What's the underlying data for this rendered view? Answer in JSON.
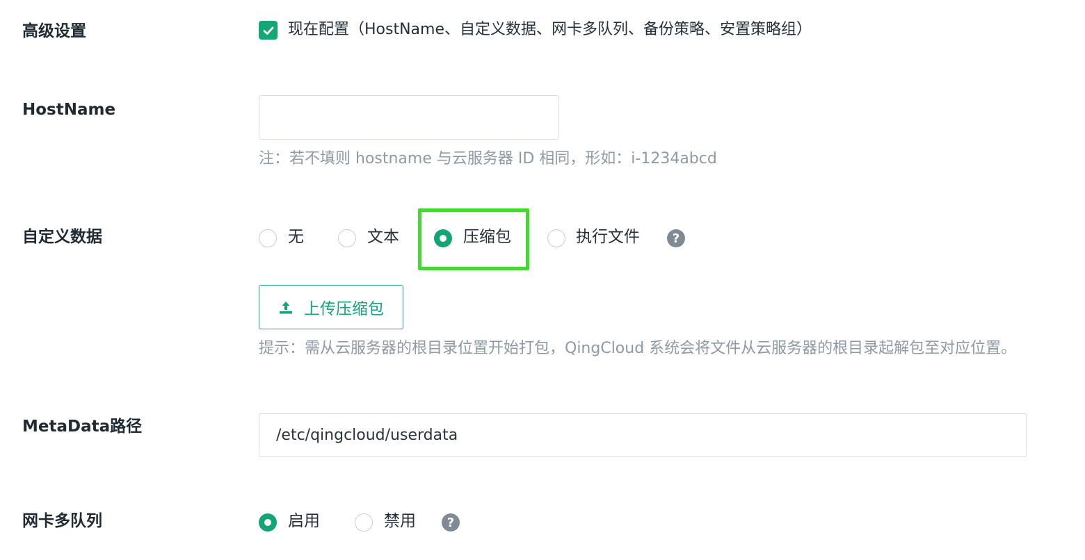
{
  "advanced": {
    "label": "高级设置",
    "checkbox_checked": true,
    "checkbox_text": "现在配置（HostName、自定义数据、网卡多队列、备份策略、安置策略组）"
  },
  "hostname": {
    "label": "HostName",
    "value": "",
    "placeholder": "",
    "hint": "注：若不填则 hostname 与云服务器 ID 相同，形如：i-1234abcd"
  },
  "custom_data": {
    "label": "自定义数据",
    "options": [
      {
        "label": "无",
        "selected": false
      },
      {
        "label": "文本",
        "selected": false
      },
      {
        "label": "压缩包",
        "selected": true
      },
      {
        "label": "执行文件",
        "selected": false
      }
    ],
    "help_icon": "question-circle-icon",
    "upload_button": "上传压缩包",
    "upload_icon": "upload-icon",
    "hint": "提示：需从云服务器的根目录位置开始打包，QingCloud 系统会将文件从云服务器的根目录起解包至对应位置。"
  },
  "metadata": {
    "label": "MetaData路径",
    "value": "/etc/qingcloud/userdata"
  },
  "nic_queue": {
    "label": "网卡多队列",
    "options": [
      {
        "label": "启用",
        "selected": true
      },
      {
        "label": "禁用",
        "selected": false
      }
    ],
    "help_icon": "question-circle-icon"
  },
  "colors": {
    "accent": "#14a574",
    "highlight": "#44d92f",
    "hint_text": "#8d9aa6"
  }
}
